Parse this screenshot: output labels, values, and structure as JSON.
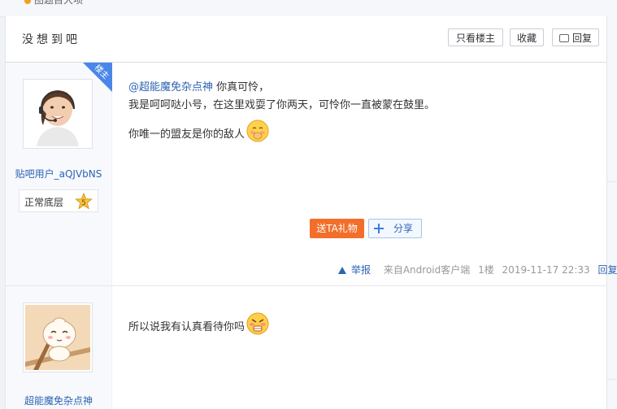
{
  "top_strip": {
    "text": "图题目大项"
  },
  "thread": {
    "title": "没想到吧",
    "buttons": {
      "only_host": "只看楼主",
      "collect": "收藏",
      "reply": "回复"
    }
  },
  "posts": [
    {
      "host_badge": "楼主",
      "author": "贴吧用户_aQJVbNS",
      "level_name": "正常底层",
      "level_num": "5",
      "mention": "@超能魔免杂点神",
      "line1_rest": " 你真可怜，",
      "line2": "我是呵呵哒小号，在这里戏耍了你两天，可怜你一直被蒙在鼓里。",
      "line3": "你唯一的盟友是你的敌人",
      "emoji": "shy-face-emoji",
      "gift_label": "送TA礼物",
      "share_label": "分享",
      "report_label": "举报",
      "source": "来自Android客户端",
      "floor": "1楼",
      "time": "2019-11-17 22:33",
      "reply_label": "回复"
    },
    {
      "author": "超能魔免杂点神",
      "text": "所以说我有认真看待你吗",
      "emoji": "angry-face-emoji"
    }
  ],
  "colors": {
    "link": "#2d64b3",
    "gift": "#f26e2a",
    "host_badge": "#4a86e8"
  }
}
